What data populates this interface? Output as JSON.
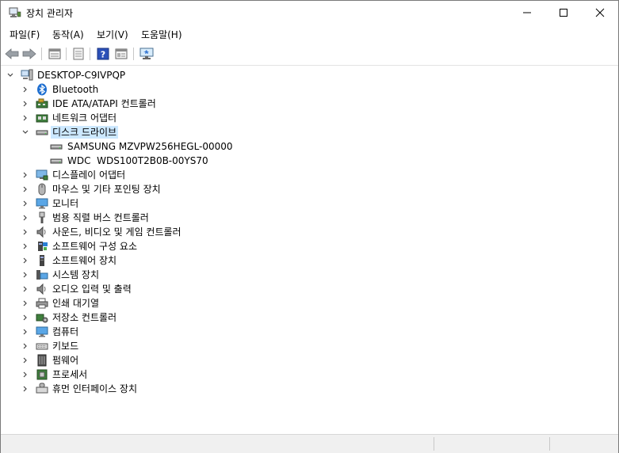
{
  "window": {
    "title": "장치 관리자",
    "buttons": {
      "minimize": "minimize-icon",
      "maximize": "maximize-icon",
      "close": "close-icon"
    }
  },
  "menu": [
    {
      "label": "파일(F)"
    },
    {
      "label": "동작(A)"
    },
    {
      "label": "보기(V)"
    },
    {
      "label": "도움말(H)"
    }
  ],
  "toolbar": [
    "back-arrow-icon",
    "forward-arrow-icon",
    "properties-icon",
    "update-icon",
    "help-icon",
    "view-icon",
    "monitor-scan-icon"
  ],
  "tree": {
    "root": "DESKTOP-C9IVPQP",
    "items": [
      {
        "label": "Bluetooth",
        "icon": "bluetooth-icon",
        "expanded": false
      },
      {
        "label": "IDE ATA/ATAPI 컨트롤러",
        "icon": "controller-icon",
        "expanded": false
      },
      {
        "label": "네트워크 어댑터",
        "icon": "network-icon",
        "expanded": false
      },
      {
        "label": "디스크 드라이브",
        "icon": "disk-icon",
        "expanded": true,
        "selected": true,
        "children": [
          {
            "label": "SAMSUNG MZVPW256HEGL-00000",
            "icon": "disk-icon"
          },
          {
            "label": "WDC  WDS100T2B0B-00YS70",
            "icon": "disk-icon"
          }
        ]
      },
      {
        "label": "디스플레이 어댑터",
        "icon": "display-adapter-icon",
        "expanded": false
      },
      {
        "label": "마우스 및 기타 포인팅 장치",
        "icon": "mouse-icon",
        "expanded": false
      },
      {
        "label": "모니터",
        "icon": "monitor-icon",
        "expanded": false
      },
      {
        "label": "범용 직렬 버스 컨트롤러",
        "icon": "usb-icon",
        "expanded": false
      },
      {
        "label": "사운드, 비디오 및 게임 컨트롤러",
        "icon": "sound-icon",
        "expanded": false
      },
      {
        "label": "소프트웨어 구성 요소",
        "icon": "software-component-icon",
        "expanded": false
      },
      {
        "label": "소프트웨어 장치",
        "icon": "software-device-icon",
        "expanded": false
      },
      {
        "label": "시스템 장치",
        "icon": "system-device-icon",
        "expanded": false
      },
      {
        "label": "오디오 입력 및 출력",
        "icon": "audio-icon",
        "expanded": false
      },
      {
        "label": "인쇄 대기열",
        "icon": "printer-icon",
        "expanded": false
      },
      {
        "label": "저장소 컨트롤러",
        "icon": "storage-controller-icon",
        "expanded": false
      },
      {
        "label": "컴퓨터",
        "icon": "computer-icon",
        "expanded": false
      },
      {
        "label": "키보드",
        "icon": "keyboard-icon",
        "expanded": false
      },
      {
        "label": "펌웨어",
        "icon": "firmware-icon",
        "expanded": false
      },
      {
        "label": "프로세서",
        "icon": "processor-icon",
        "expanded": false
      },
      {
        "label": "휴먼 인터페이스 장치",
        "icon": "hid-icon",
        "expanded": false
      }
    ]
  }
}
